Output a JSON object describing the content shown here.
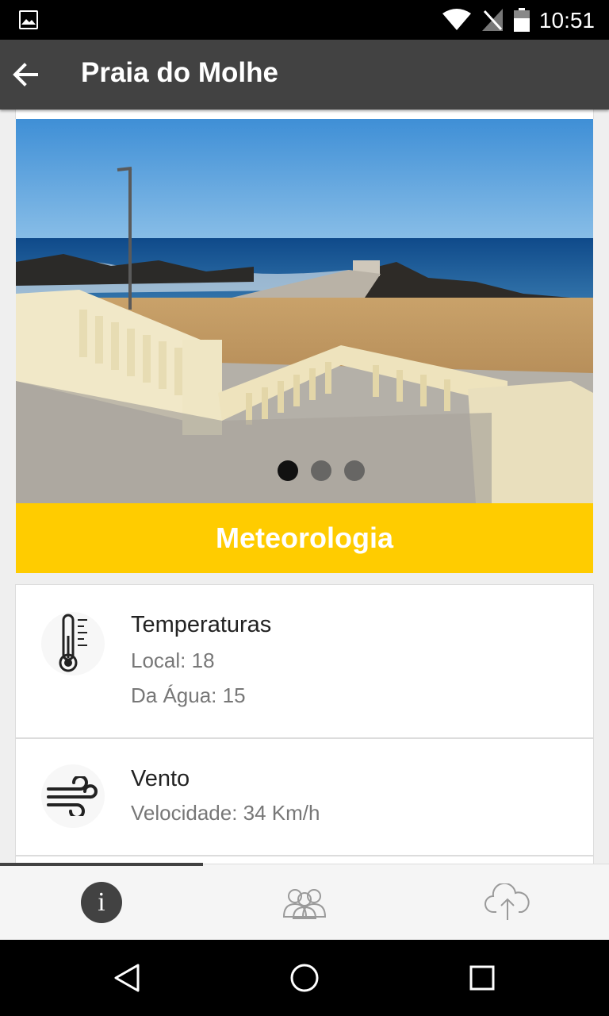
{
  "status_bar": {
    "time": "10:51",
    "icons": [
      "gallery-icon",
      "wifi-icon",
      "no-signal-icon",
      "battery-icon"
    ]
  },
  "app_bar": {
    "title": "Praia do Molhe",
    "back_icon": "arrow-back-icon"
  },
  "carousel": {
    "page_count": 3,
    "active_page": 1
  },
  "section": {
    "title": "Meteorologia",
    "color": "#ffcc00"
  },
  "weather": {
    "temperatures": {
      "heading": "Temperaturas",
      "local": "Local: 18",
      "water": "Da Água: 15",
      "icon": "thermometer-icon"
    },
    "wind": {
      "heading": "Vento",
      "speed": "Velocidade: 34 Km/h",
      "icon": "wind-icon"
    }
  },
  "bottom_tabs": [
    {
      "icon": "info-icon",
      "label": "i",
      "active": true
    },
    {
      "icon": "people-icon",
      "active": false
    },
    {
      "icon": "cloud-upload-icon",
      "active": false
    }
  ],
  "colors": {
    "app_bar": "#424242",
    "accent": "#ffcc00"
  }
}
